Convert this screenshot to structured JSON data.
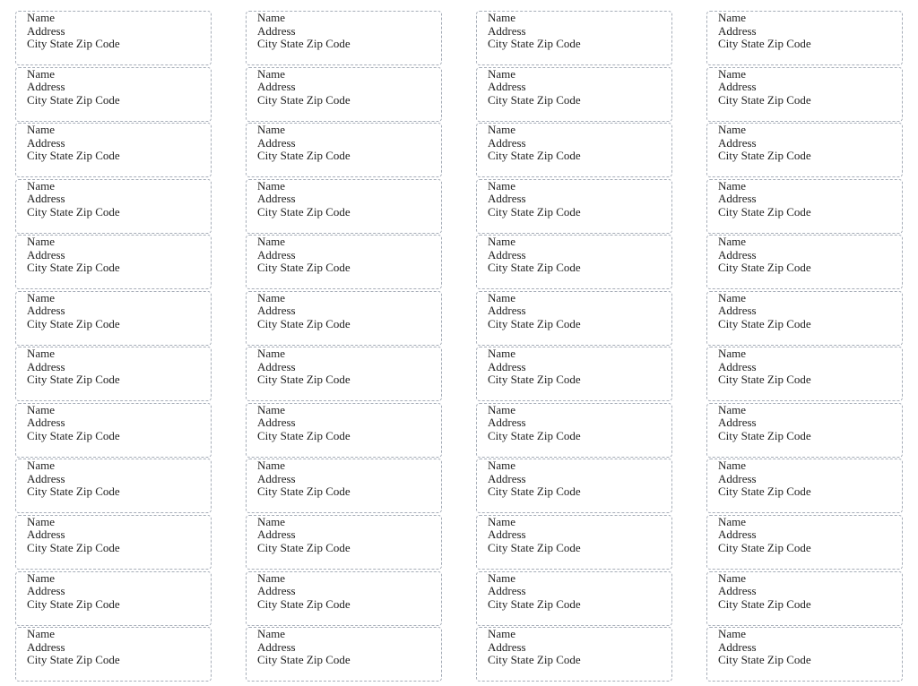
{
  "sheet": {
    "columns": 4,
    "rows": 12,
    "border_color": "#a6adb8",
    "label_template": {
      "name": "Name",
      "address": "Address",
      "city_line": "City State Zip Code"
    }
  },
  "labels": [
    {
      "name": "Name",
      "address": "Address",
      "city_line": "City State Zip Code"
    },
    {
      "name": "Name",
      "address": "Address",
      "city_line": "City State Zip Code"
    },
    {
      "name": "Name",
      "address": "Address",
      "city_line": "City State Zip Code"
    },
    {
      "name": "Name",
      "address": "Address",
      "city_line": "City State Zip Code"
    },
    {
      "name": "Name",
      "address": "Address",
      "city_line": "City State Zip Code"
    },
    {
      "name": "Name",
      "address": "Address",
      "city_line": "City State Zip Code"
    },
    {
      "name": "Name",
      "address": "Address",
      "city_line": "City State Zip Code"
    },
    {
      "name": "Name",
      "address": "Address",
      "city_line": "City State Zip Code"
    },
    {
      "name": "Name",
      "address": "Address",
      "city_line": "City State Zip Code"
    },
    {
      "name": "Name",
      "address": "Address",
      "city_line": "City State Zip Code"
    },
    {
      "name": "Name",
      "address": "Address",
      "city_line": "City State Zip Code"
    },
    {
      "name": "Name",
      "address": "Address",
      "city_line": "City State Zip Code"
    },
    {
      "name": "Name",
      "address": "Address",
      "city_line": "City State Zip Code"
    },
    {
      "name": "Name",
      "address": "Address",
      "city_line": "City State Zip Code"
    },
    {
      "name": "Name",
      "address": "Address",
      "city_line": "City State Zip Code"
    },
    {
      "name": "Name",
      "address": "Address",
      "city_line": "City State Zip Code"
    },
    {
      "name": "Name",
      "address": "Address",
      "city_line": "City State Zip Code"
    },
    {
      "name": "Name",
      "address": "Address",
      "city_line": "City State Zip Code"
    },
    {
      "name": "Name",
      "address": "Address",
      "city_line": "City State Zip Code"
    },
    {
      "name": "Name",
      "address": "Address",
      "city_line": "City State Zip Code"
    },
    {
      "name": "Name",
      "address": "Address",
      "city_line": "City State Zip Code"
    },
    {
      "name": "Name",
      "address": "Address",
      "city_line": "City State Zip Code"
    },
    {
      "name": "Name",
      "address": "Address",
      "city_line": "City State Zip Code"
    },
    {
      "name": "Name",
      "address": "Address",
      "city_line": "City State Zip Code"
    },
    {
      "name": "Name",
      "address": "Address",
      "city_line": "City State Zip Code"
    },
    {
      "name": "Name",
      "address": "Address",
      "city_line": "City State Zip Code"
    },
    {
      "name": "Name",
      "address": "Address",
      "city_line": "City State Zip Code"
    },
    {
      "name": "Name",
      "address": "Address",
      "city_line": "City State Zip Code"
    },
    {
      "name": "Name",
      "address": "Address",
      "city_line": "City State Zip Code"
    },
    {
      "name": "Name",
      "address": "Address",
      "city_line": "City State Zip Code"
    },
    {
      "name": "Name",
      "address": "Address",
      "city_line": "City State Zip Code"
    },
    {
      "name": "Name",
      "address": "Address",
      "city_line": "City State Zip Code"
    },
    {
      "name": "Name",
      "address": "Address",
      "city_line": "City State Zip Code"
    },
    {
      "name": "Name",
      "address": "Address",
      "city_line": "City State Zip Code"
    },
    {
      "name": "Name",
      "address": "Address",
      "city_line": "City State Zip Code"
    },
    {
      "name": "Name",
      "address": "Address",
      "city_line": "City State Zip Code"
    },
    {
      "name": "Name",
      "address": "Address",
      "city_line": "City State Zip Code"
    },
    {
      "name": "Name",
      "address": "Address",
      "city_line": "City State Zip Code"
    },
    {
      "name": "Name",
      "address": "Address",
      "city_line": "City State Zip Code"
    },
    {
      "name": "Name",
      "address": "Address",
      "city_line": "City State Zip Code"
    },
    {
      "name": "Name",
      "address": "Address",
      "city_line": "City State Zip Code"
    },
    {
      "name": "Name",
      "address": "Address",
      "city_line": "City State Zip Code"
    },
    {
      "name": "Name",
      "address": "Address",
      "city_line": "City State Zip Code"
    },
    {
      "name": "Name",
      "address": "Address",
      "city_line": "City State Zip Code"
    },
    {
      "name": "Name",
      "address": "Address",
      "city_line": "City State Zip Code"
    },
    {
      "name": "Name",
      "address": "Address",
      "city_line": "City State Zip Code"
    },
    {
      "name": "Name",
      "address": "Address",
      "city_line": "City State Zip Code"
    },
    {
      "name": "Name",
      "address": "Address",
      "city_line": "City State Zip Code"
    }
  ]
}
